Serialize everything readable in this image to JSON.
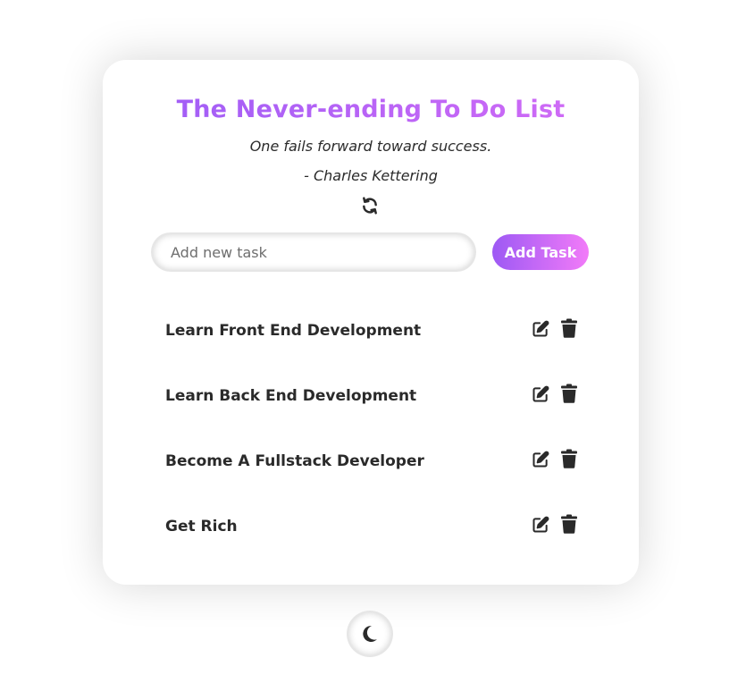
{
  "app": {
    "title": "The Never-ending To Do List",
    "quote": "One fails forward toward success.",
    "author": "- Charles Kettering"
  },
  "input": {
    "placeholder": "Add new task",
    "value": ""
  },
  "add_button": {
    "label": "Add Task"
  },
  "tasks": [
    {
      "label": "Learn Front End Development"
    },
    {
      "label": "Learn Back End Development"
    },
    {
      "label": "Become A Fullstack Developer"
    },
    {
      "label": "Get Rich"
    }
  ],
  "icons": {
    "refresh": "refresh-icon",
    "edit": "edit-icon",
    "delete": "trash-icon",
    "theme": "moon-icon"
  },
  "colors": {
    "accent_start": "#9d59f4",
    "accent_end": "#f27bf8",
    "text": "#2a2a2a"
  }
}
